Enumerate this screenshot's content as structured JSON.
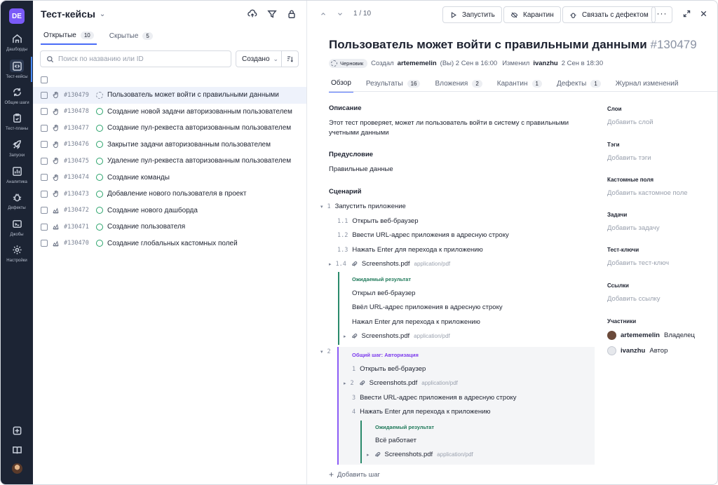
{
  "nav": {
    "workspace": "DE",
    "items": [
      {
        "label": "Дашборды",
        "icon": "dashboard-icon"
      },
      {
        "label": "Тест-кейсы",
        "icon": "code-icon"
      },
      {
        "label": "Общие шаги",
        "icon": "refresh-icon"
      },
      {
        "label": "Тест-планы",
        "icon": "clipboard-icon"
      },
      {
        "label": "Запуски",
        "icon": "rocket-icon"
      },
      {
        "label": "Аналитика",
        "icon": "chart-icon"
      },
      {
        "label": "Дефекты",
        "icon": "bug-icon"
      },
      {
        "label": "Джобы",
        "icon": "terminal-icon"
      },
      {
        "label": "Настройки",
        "icon": "gear-icon"
      }
    ]
  },
  "list": {
    "title": "Тест-кейсы",
    "tabs": [
      {
        "label": "Открытые",
        "count": "10"
      },
      {
        "label": "Скрытые",
        "count": "5"
      }
    ],
    "search_placeholder": "Поиск по названию или ID",
    "sort_label": "Создано",
    "rows": [
      {
        "id": "#130479",
        "name": "Пользователь может войти с правильными данными",
        "status": "draft",
        "type": "manual"
      },
      {
        "id": "#130478",
        "name": "Создание новой задачи авторизованным пользователем",
        "status": "active",
        "type": "manual"
      },
      {
        "id": "#130477",
        "name": "Создание пул-реквеста авторизованным пользователем",
        "status": "active",
        "type": "manual"
      },
      {
        "id": "#130476",
        "name": "Закрытие задачи авторизованным пользователем",
        "status": "active",
        "type": "manual"
      },
      {
        "id": "#130475",
        "name": "Удаление пул-реквеста авторизованным пользователем",
        "status": "active",
        "type": "manual"
      },
      {
        "id": "#130474",
        "name": "Создание команды",
        "status": "active",
        "type": "manual"
      },
      {
        "id": "#130473",
        "name": "Добавление нового пользователя в проект",
        "status": "active",
        "type": "manual"
      },
      {
        "id": "#130472",
        "name": "Создание нового дашборда",
        "status": "active",
        "type": "automated"
      },
      {
        "id": "#130471",
        "name": "Создание пользователя",
        "status": "active",
        "type": "automated"
      },
      {
        "id": "#130470",
        "name": "Создание глобальных кастомных полей",
        "status": "active",
        "type": "automated"
      }
    ]
  },
  "detail": {
    "pager": "1 / 10",
    "buttons": {
      "run": "Запустить",
      "quarantine": "Карантин",
      "link_defect": "Связать с дефектом"
    },
    "title": "Пользователь может войти с правильными данными",
    "number": "#130479",
    "status_badge": "Черновик",
    "meta": {
      "created_prefix": "Создал",
      "created_by": "artememelin",
      "created_suffix": "(Вы) 2 Сен в 16:00",
      "changed_prefix": "Изменил",
      "changed_by": "ivanzhu",
      "changed_suffix": "2 Сен в 18:30"
    },
    "tabs": [
      {
        "label": "Обзор",
        "count": ""
      },
      {
        "label": "Результаты",
        "count": "16"
      },
      {
        "label": "Вложения",
        "count": "2"
      },
      {
        "label": "Карантин",
        "count": "1"
      },
      {
        "label": "Дефекты",
        "count": "1"
      },
      {
        "label": "Журнал изменений",
        "count": ""
      }
    ],
    "description_h": "Описание",
    "description_l1": "Этот тест проверяет, может ли пользователь войти в систему с правильными",
    "description_l2": "учетными данными",
    "precondition_h": "Предусловие",
    "precondition": "Правильные данные",
    "scenario_h": "Сценарий",
    "steps": {
      "s1": {
        "n": "1",
        "text": "Запустить приложение"
      },
      "s11": {
        "n": "1.1",
        "text": "Открыть веб-браузер"
      },
      "s12": {
        "n": "1.2",
        "text": "Ввести URL-адрес приложения в адресную строку"
      },
      "s13": {
        "n": "1.3",
        "text": "Нажать Enter для перехода к приложению"
      },
      "s14": {
        "n": "1.4",
        "text": "Screenshots.pdf",
        "mime": "application/pdf"
      },
      "exp_label": "Ожидаемый результат",
      "e1": "Открыл веб-браузер",
      "e2": "Ввёл URL-адрес приложения в адресную строку",
      "e3": "Нажал Enter для перехода к приложению",
      "e4": {
        "text": "Screenshots.pdf",
        "mime": "application/pdf"
      },
      "s2": {
        "n": "2"
      },
      "shared_label": "Общий шаг: Авторизация",
      "sh1": {
        "n": "1",
        "text": "Открыть веб-браузер"
      },
      "sh2": {
        "n": "2",
        "text": "Screenshots.pdf",
        "mime": "application/pdf"
      },
      "sh3": {
        "n": "3",
        "text": "Ввести URL-адрес приложения в адресную строку"
      },
      "sh4": {
        "n": "4",
        "text": "Нажать Enter для перехода к приложению"
      },
      "sh_exp_label": "Ожидаемый результат",
      "sh_e1": "Всё работает",
      "sh_e2": {
        "text": "Screenshots.pdf",
        "mime": "application/pdf"
      }
    },
    "add_step": "Добавить шаг",
    "sidebar": {
      "layers_h": "Слои",
      "layers_v": "Добавить слой",
      "tags_h": "Тэги",
      "tags_v": "Добавить тэги",
      "custom_h": "Кастомные поля",
      "custom_v": "Добавить кастомное поле",
      "tasks_h": "Задачи",
      "tasks_v": "Добавить задачу",
      "keys_h": "Тест-ключи",
      "keys_v": "Добавить тест-ключ",
      "links_h": "Ссылки",
      "links_v": "Добавить ссылку",
      "members_h": "Участники",
      "members": [
        {
          "name": "artememelin",
          "role": "Владелец"
        },
        {
          "name": "ivanzhu",
          "role": "Автор"
        }
      ]
    }
  },
  "colors": {
    "accent": "#4a6cf7",
    "nav_bg": "#1c2434",
    "passed": "#2aa36b",
    "shared": "#8b5cf6",
    "expected": "#2a8a6b"
  }
}
